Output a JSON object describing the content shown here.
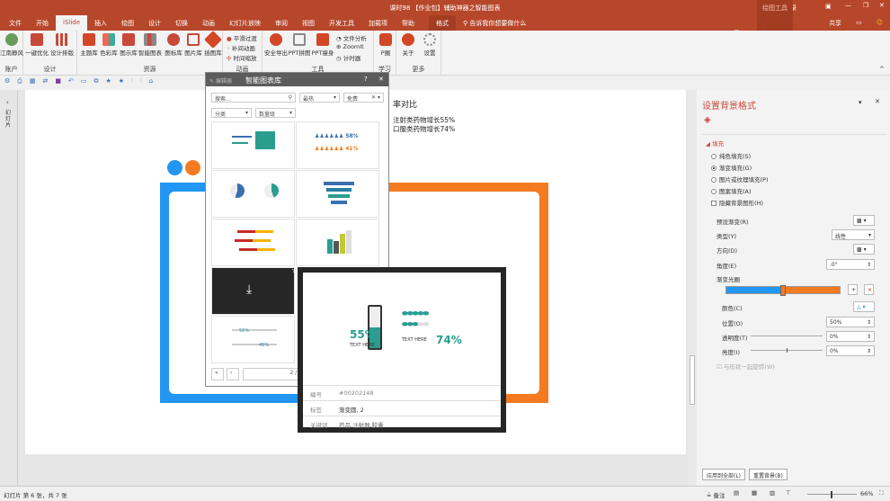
{
  "window": {
    "title": "课时98 【作业包】辅助神器之智能图表",
    "context_tab": "绘图工具",
    "login": "登录",
    "share": "共享"
  },
  "tabs": [
    "文件",
    "开始",
    "iSlide",
    "插入",
    "绘图",
    "设计",
    "切换",
    "动画",
    "幻灯片放映",
    "审阅",
    "视图",
    "开发工具",
    "加载项",
    "帮助",
    "格式"
  ],
  "tell_me": "告诉我你想要做什么",
  "ribbon": {
    "account": {
      "label": "账户",
      "user": "江南静风"
    },
    "design": {
      "label": "设计",
      "items": [
        "一键优化",
        "设计排版"
      ]
    },
    "resources": {
      "label": "资源",
      "items": [
        "主题库",
        "色彩库",
        "图示库",
        "智能图表",
        "图标库",
        "图片库",
        "插图库"
      ]
    },
    "animation": {
      "label": "动画",
      "items": [
        "平滑过渡",
        "补间动画",
        "时间缩放"
      ]
    },
    "tools": {
      "label": "工具",
      "items": [
        "安全导出",
        "PPT拼图",
        "PPT瘦身"
      ],
      "small": [
        "文件分析",
        "ZoomIt",
        "计时器"
      ]
    },
    "learn": {
      "label": "学习",
      "items": [
        "P圈"
      ]
    },
    "more": {
      "label": "更多",
      "items": [
        "关于",
        "设置"
      ]
    }
  },
  "left_pane": {
    "label": "幻灯片"
  },
  "slide": {
    "title": "率对比",
    "line1": "注射类药物增长55%",
    "line2": "口服类药物增长74%",
    "colors": {
      "blue": "#2196f3",
      "orange": "#f47b20"
    }
  },
  "chart_library": {
    "edit_label": "编辑器",
    "title": "智能图表库",
    "search_placeholder": "搜索...",
    "sort": "最热",
    "filter": "免费",
    "category": "分类",
    "quantity": "数量级",
    "page": "2 / 1",
    "thumbs": [
      {
        "a": "58%",
        "b": "41%"
      },
      {
        "a": "55%",
        "b": "45%"
      }
    ]
  },
  "preview": {
    "pct_left": "55%",
    "pct_right": "74%",
    "text_here": "TEXT HERE",
    "rows": [
      {
        "k": "编号",
        "v": "#00202148"
      },
      {
        "k": "标签",
        "v": "渐变圆, 2"
      },
      {
        "k": "关键词",
        "v": "药品,注射器,胶囊"
      }
    ]
  },
  "format_panel": {
    "title": "设置背景格式",
    "section": "填充",
    "fill_options": [
      "纯色填充(S)",
      "渐变填充(G)",
      "图片或纹理填充(P)",
      "图案填充(A)"
    ],
    "selected_fill": 1,
    "hide_bg": "隐藏背景图形(H)",
    "preset": "预设渐变(R)",
    "type_label": "类型(Y)",
    "type_value": "线性",
    "direction": "方向(D)",
    "angle_label": "角度(E)",
    "angle_value": ".0°",
    "stops_label": "渐变光圈",
    "stop_position": 0.5,
    "color_label": "颜色(C)",
    "position_label": "位置(O)",
    "position_value": "50%",
    "transparency_label": "透明度(T)",
    "transparency_value": "0%",
    "brightness_label": "亮度(I)",
    "brightness_value": "0%",
    "rotate_with_shape": "与形状一起旋转(W)",
    "apply_all": "应用到全部(L)",
    "reset": "重置背景(B)"
  },
  "status": {
    "slide": "幻灯片 第 6 张，共 7 张",
    "notes": "备注",
    "zoom": "66%"
  }
}
